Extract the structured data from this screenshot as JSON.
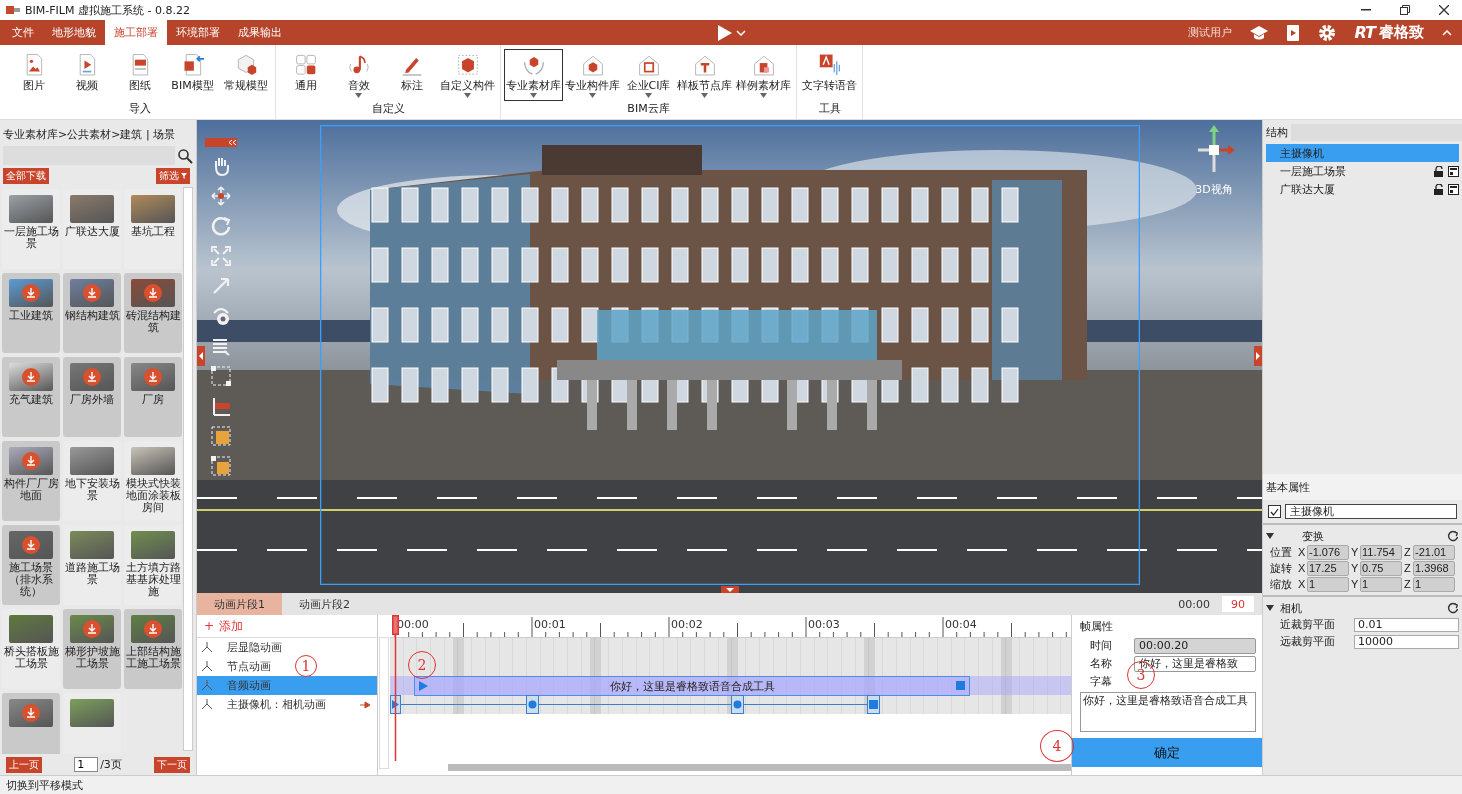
{
  "window": {
    "title": "BIM-FILM 虚拟施工系统 - 0.8.22"
  },
  "menu_tabs": [
    {
      "label": "文件",
      "selected": false
    },
    {
      "label": "地形地貌",
      "selected": false
    },
    {
      "label": "施工部署",
      "selected": true
    },
    {
      "label": "环境部署",
      "selected": false
    },
    {
      "label": "成果输出",
      "selected": false
    }
  ],
  "user": "测试用户",
  "logo": {
    "mark": "RT",
    "name": "睿格致"
  },
  "ribbon_groups": [
    {
      "label": "导入",
      "tools": [
        {
          "label": "图片",
          "dropdown": false,
          "selected": false
        },
        {
          "label": "视频",
          "dropdown": false,
          "selected": false
        },
        {
          "label": "图纸",
          "dropdown": false,
          "selected": false
        },
        {
          "label": "BIM模型",
          "dropdown": false,
          "selected": false
        },
        {
          "label": "常规模型",
          "dropdown": false,
          "selected": false
        }
      ]
    },
    {
      "label": "自定义",
      "tools": [
        {
          "label": "通用",
          "dropdown": false,
          "selected": false
        },
        {
          "label": "音效",
          "dropdown": true,
          "selected": false
        },
        {
          "label": "标注",
          "dropdown": false,
          "selected": false
        },
        {
          "label": "自定义构件",
          "dropdown": true,
          "selected": false
        }
      ]
    },
    {
      "label": "BIM云库",
      "tools": [
        {
          "label": "专业素材库",
          "dropdown": true,
          "selected": true
        },
        {
          "label": "专业构件库",
          "dropdown": true,
          "selected": false
        },
        {
          "label": "企业CI库",
          "dropdown": true,
          "selected": false
        },
        {
          "label": "样板节点库",
          "dropdown": true,
          "selected": false
        },
        {
          "label": "样例素材库",
          "dropdown": true,
          "selected": false
        }
      ]
    },
    {
      "label": "工具",
      "tools": [
        {
          "label": "文字转语音",
          "dropdown": false,
          "selected": false
        }
      ]
    }
  ],
  "asset_panel": {
    "breadcrumb": "专业素材库>公共素材>建筑 | 场景",
    "download_all": "全部下载",
    "filter": "筛选",
    "items": [
      {
        "label": "一层施工场景",
        "downloadable": false
      },
      {
        "label": "广联达大厦",
        "downloadable": false
      },
      {
        "label": "基坑工程",
        "downloadable": false
      },
      {
        "label": "工业建筑",
        "downloadable": true
      },
      {
        "label": "钢结构建筑",
        "downloadable": true
      },
      {
        "label": "砖混结构建筑",
        "downloadable": true
      },
      {
        "label": "充气建筑",
        "downloadable": true
      },
      {
        "label": "厂房外墙",
        "downloadable": true
      },
      {
        "label": "厂房",
        "downloadable": true
      },
      {
        "label": "构件厂厂房地面",
        "downloadable": true
      },
      {
        "label": "地下安装场景",
        "downloadable": false
      },
      {
        "label": "模块式快装地面涂装板房间",
        "downloadable": false
      },
      {
        "label": "施工场景（排水系统）",
        "downloadable": true
      },
      {
        "label": "道路施工场景",
        "downloadable": false
      },
      {
        "label": "土方填方路基基床处理施",
        "downloadable": false
      },
      {
        "label": "桥头搭板施工场景",
        "downloadable": false
      },
      {
        "label": "梯形护坡施工场景",
        "downloadable": true
      },
      {
        "label": "上部结构施工施工场景",
        "downloadable": true
      },
      {
        "downloadable": true
      },
      {
        "downloadable": false
      }
    ],
    "pager": {
      "prev": "上一页",
      "page": "1",
      "total": "/3页",
      "next": "下一页"
    }
  },
  "viewport": {
    "view_label": "3D视角"
  },
  "structure": {
    "title": "结构",
    "items": [
      {
        "label": "主摄像机",
        "kind": "camera",
        "selected": true
      },
      {
        "label": "一层施工场景",
        "kind": "model",
        "selected": false
      },
      {
        "label": "广联达大厦",
        "kind": "model",
        "selected": false
      }
    ]
  },
  "basic_properties": {
    "title": "基本属性",
    "visible": true,
    "name": "主摄像机"
  },
  "transform": {
    "title": "变换",
    "expanded": true,
    "rows": [
      {
        "label": "位置",
        "values": [
          {
            "axis": "X",
            "value": "-1.076"
          },
          {
            "axis": "Y",
            "value": "11.754"
          },
          {
            "axis": "Z",
            "value": "-21.01"
          }
        ]
      },
      {
        "label": "旋转",
        "values": [
          {
            "axis": "X",
            "value": "17.25"
          },
          {
            "axis": "Y",
            "value": "0.75"
          },
          {
            "axis": "Z",
            "value": "1.3968"
          }
        ]
      },
      {
        "label": "缩放",
        "values": [
          {
            "axis": "X",
            "value": "1"
          },
          {
            "axis": "Y",
            "value": "1"
          },
          {
            "axis": "Z",
            "value": "1"
          }
        ]
      }
    ]
  },
  "camera": {
    "title": "相机",
    "expanded": true,
    "fields": [
      {
        "label": "近裁剪平面",
        "value": "0.01"
      },
      {
        "label": "远裁剪平面",
        "value": "10000"
      }
    ]
  },
  "timeline": {
    "tabs": [
      {
        "label": "动画片段1",
        "selected": true
      },
      {
        "label": "动画片段2",
        "selected": false
      }
    ],
    "time": "00:00",
    "frames": "90",
    "add": {
      "icon": "+",
      "label": "添加"
    },
    "tracks": [
      {
        "label": "层显隐动画",
        "selected": false,
        "pinned": false
      },
      {
        "label": "节点动画",
        "selected": false,
        "pinned": false
      },
      {
        "label": "音频动画",
        "selected": true,
        "pinned": false
      },
      {
        "label": "主摄像机：相机动画",
        "selected": false,
        "pinned": true
      }
    ],
    "ruler": [
      "00:00",
      "00:01",
      "00:02",
      "00:03",
      "00:04"
    ],
    "audio_clip": "你好，这里是睿格致语音合成工具"
  },
  "frame_properties": {
    "title": "帧属性",
    "time": {
      "label": "时间",
      "value": "00:00.20"
    },
    "name": {
      "label": "名称",
      "value": "你好，这里是睿格致"
    },
    "subtitle": {
      "label": "字幕",
      "value": "你好，这里是睿格致语音合成工具"
    },
    "confirm": "确定"
  },
  "annotations": [
    "1",
    "2",
    "3",
    "4"
  ],
  "status": "切换到平移模式"
}
